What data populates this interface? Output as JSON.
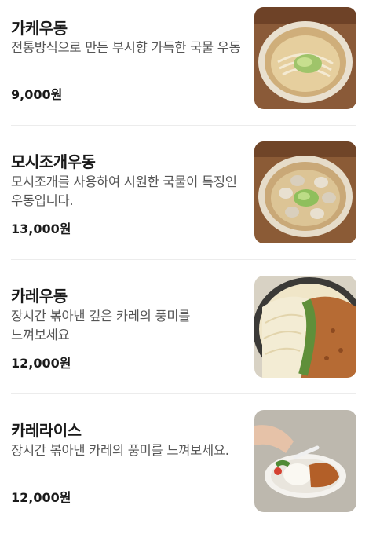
{
  "menu": {
    "items": [
      {
        "name": "가케우동",
        "description": "전통방식으로 만든 부시향 가득한 국물 우동",
        "price": "9,000원",
        "image_icon": "kake-udon-photo"
      },
      {
        "name": "모시조개우동",
        "description": "모시조개를 사용하여 시원한 국물이 특징인 우동입니다.",
        "price": "13,000원",
        "image_icon": "clam-udon-photo"
      },
      {
        "name": "카레우동",
        "description": "장시간 볶아낸 깊은 카레의 풍미를 느껴보세요",
        "price": "12,000원",
        "image_icon": "curry-udon-photo"
      },
      {
        "name": "카레라이스",
        "description": "장시간 볶아낸 카레의 풍미를 느껴보세요.",
        "price": "12,000원",
        "image_icon": "curry-rice-photo"
      }
    ]
  }
}
